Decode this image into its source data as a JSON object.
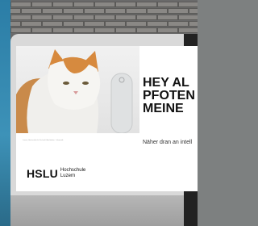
{
  "poster": {
    "caption": "Luzern, Hochschule für Technik & Architektur · Informatik",
    "headline": [
      "HEY AL",
      "PFOTEN",
      "MEINE"
    ],
    "subline": "Näher dran an intell",
    "logo": {
      "mark": "HSLU",
      "words": [
        "Hochschule",
        "Luzern"
      ]
    }
  },
  "colors": {
    "sky": "#2b7da6",
    "poster_bg": "#ffffff",
    "frame": "#d9d9d9",
    "speaker": "#dfe1e2"
  }
}
